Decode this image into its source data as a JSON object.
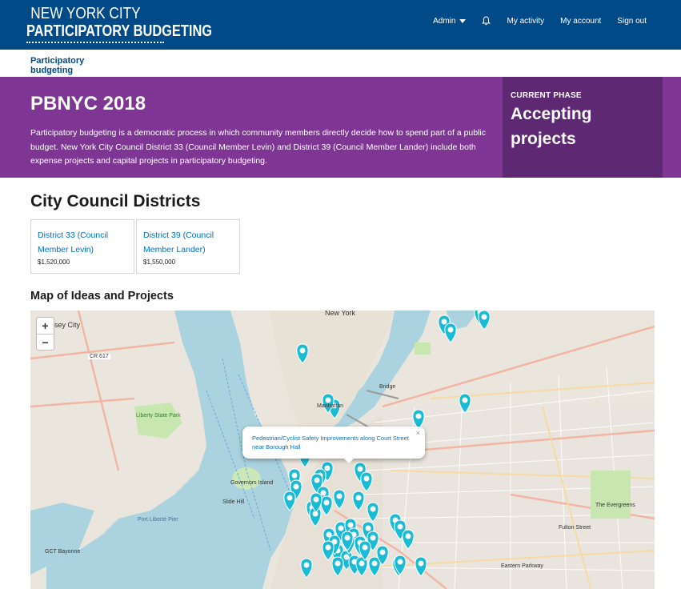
{
  "header": {
    "logo_line1": "NEW YORK CITY",
    "logo_line2": "PARTICIPATORY BUDGETING",
    "nav": {
      "admin": "Admin",
      "my_activity": "My activity",
      "my_account": "My account",
      "sign_out": "Sign out"
    },
    "bg_color": "#004a87"
  },
  "subnav": {
    "tab": "Participatory budgeting"
  },
  "hero": {
    "title": "PBNYC 2018",
    "description": "Participatory budgeting is a democratic process in which community members directly decide how to spend part of a public budget. New York City Council District 33 (Council Member Levin) and District 39 (Council Member Lander) include both expense projects and capital projects in participatory budgeting.",
    "phase_label": "CURRENT PHASE",
    "phase_value": "Accepting projects",
    "bg_color": "#7f3593",
    "phase_bg_color": "#5e2873"
  },
  "districts": {
    "title": "City Council Districts",
    "items": [
      {
        "name": "District 33 (Council Member Levin)",
        "amount": "$1,520,000"
      },
      {
        "name": "District 39 (Council Member Lander)",
        "amount": "$1,550,000"
      }
    ]
  },
  "map": {
    "title": "Map of Ideas and Projects",
    "zoom_in": "+",
    "zoom_out": "−",
    "popup_text": "Pedestrian/Cyclist Safety Improvements along Court Street near Borough Hall",
    "popup_close": "×",
    "marker_color": "#19bcd4",
    "labels": {
      "new_york": "New York",
      "jersey_city": "sey City",
      "manhattan": "Manhattan",
      "bridge": "Bridge",
      "liberty_state_park": "Liberty State Park",
      "governors_island": "Governors Island",
      "slide_hill": "Slide Hill",
      "bayonne": "GCT Bayonne",
      "port_liberte": "Port Liberté Pier",
      "fulton_street": "Fulton Street",
      "eastern_parkway": "Eastern Parkway",
      "cr617": "CR 617",
      "evergreens": "The Evergreens"
    }
  }
}
